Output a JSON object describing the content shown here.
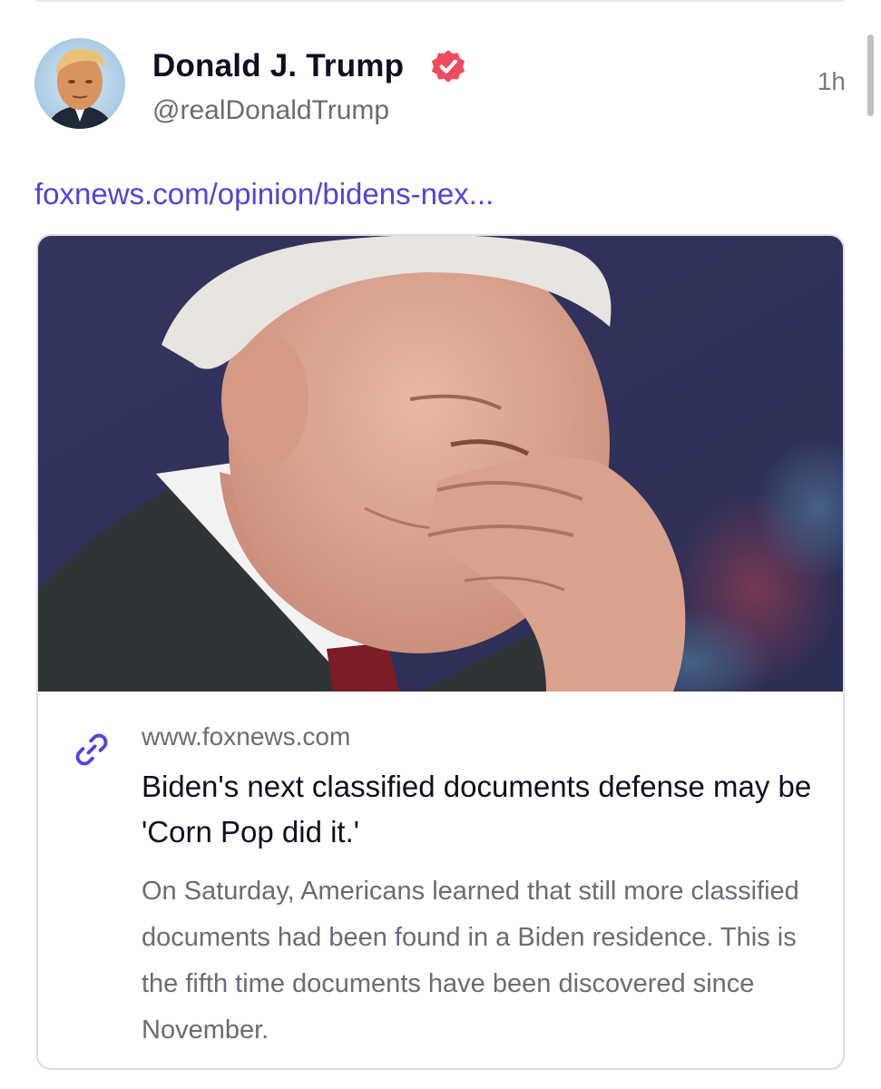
{
  "post": {
    "author_name": "Donald J. Trump",
    "handle": "@realDonaldTrump",
    "timestamp": "1h",
    "verified": true,
    "link_text": "foxnews.com/opinion/bidens-nex..."
  },
  "card": {
    "domain": "www.foxnews.com",
    "title": "Biden's next classified documents defense may be 'Corn Pop did it.'",
    "description": "On Saturday, Americans learned that still more classified documents had been found in a Biden residence. This is the fifth time documents have been discovered since November."
  },
  "icons": {
    "verified": "verified-badge-icon",
    "link": "link-icon"
  },
  "colors": {
    "accent": "#5243e0",
    "verified_badge": "#ef4a5d",
    "text_primary": "#0f0f23",
    "text_secondary": "#6b6b78",
    "card_border": "#dcdce4"
  }
}
